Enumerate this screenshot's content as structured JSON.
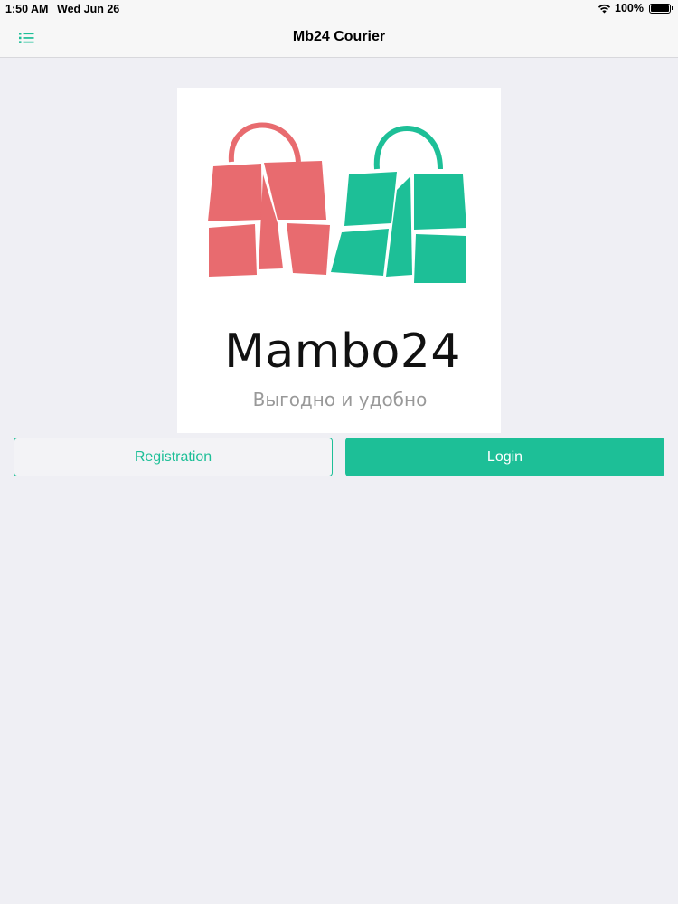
{
  "status_bar": {
    "time": "1:50 AM",
    "date": "Wed Jun 26",
    "battery": "100%"
  },
  "nav": {
    "title": "Mb24 Courier",
    "menu_icon": "list-icon"
  },
  "logo": {
    "name": "Mambo24",
    "tagline": "Выгодно и удобно",
    "left_bag_color": "#e86b6f",
    "right_bag_color": "#1dbf97"
  },
  "actions": {
    "registration_label": "Registration",
    "login_label": "Login"
  },
  "colors": {
    "accent": "#1dbf97",
    "background": "#efeff4"
  }
}
